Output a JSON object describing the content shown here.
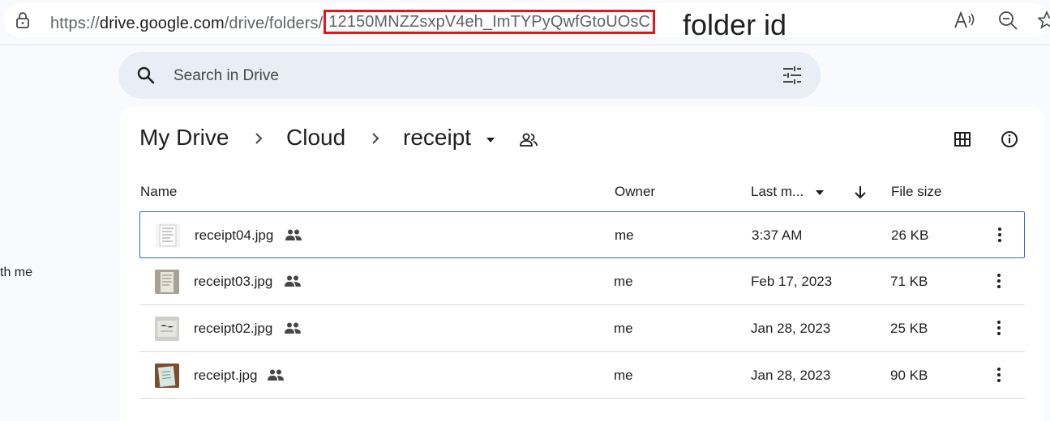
{
  "browser": {
    "url_prefix": "https://",
    "url_host": "drive.google.com",
    "url_path": "/drive/folders/",
    "folder_id": "12150MNZZsxpV4eh_ImTYPyQwfGtoUOsC",
    "annotation_label": "folder id",
    "highlight_color": "#e8141b"
  },
  "left_nav": {
    "partial_item": "th me"
  },
  "search": {
    "placeholder": "Search in Drive"
  },
  "breadcrumb": {
    "items": [
      "My Drive",
      "Cloud",
      "receipt"
    ]
  },
  "table": {
    "columns": {
      "name": "Name",
      "owner": "Owner",
      "last_modified": "Last m...",
      "file_size": "File size"
    },
    "rows": [
      {
        "name": "receipt04.jpg",
        "owner": "me",
        "modified": "3:37 AM",
        "size": "26 KB",
        "selected": true
      },
      {
        "name": "receipt03.jpg",
        "owner": "me",
        "modified": "Feb 17, 2023",
        "size": "71 KB",
        "selected": false
      },
      {
        "name": "receipt02.jpg",
        "owner": "me",
        "modified": "Jan 28, 2023",
        "size": "25 KB",
        "selected": false
      },
      {
        "name": "receipt.jpg",
        "owner": "me",
        "modified": "Jan 28, 2023",
        "size": "90 KB",
        "selected": false
      }
    ]
  },
  "colors": {
    "selection_border": "#3b63d6",
    "search_bg": "#e9eef6"
  }
}
